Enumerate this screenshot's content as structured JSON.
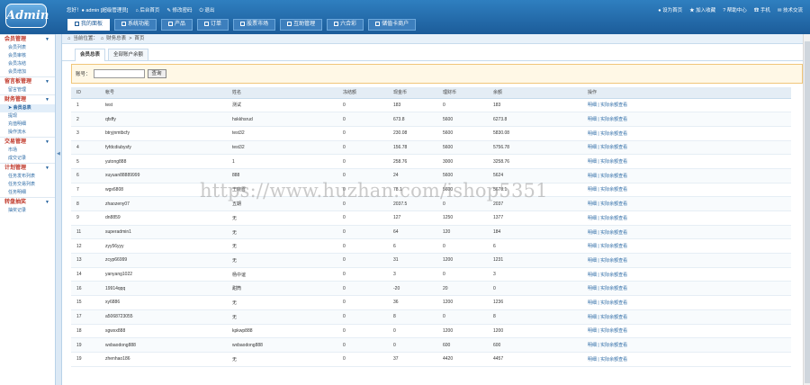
{
  "app": {
    "logo": "Admin",
    "user_prefix": "您好！",
    "user_name": "admin",
    "user_role": "[超级管理员]",
    "links": [
      "后台首页",
      "修改密码",
      "退出"
    ],
    "right_links": [
      "设为首页",
      "加入收藏",
      "帮助中心",
      "手机",
      "技术交流"
    ]
  },
  "tabs": [
    "我的面板",
    "系统功能",
    "产品",
    "订单",
    "股票市场",
    "互助管理",
    "六合彩",
    "储值卡商户"
  ],
  "sidebar": [
    {
      "title": "会员管理",
      "items": [
        "会员列表",
        "会员审核",
        "会员冻结",
        "会员增加"
      ]
    },
    {
      "title": "留言板管理",
      "items": [
        "留言管理"
      ]
    },
    {
      "title": "财务管理",
      "items": [
        "会员总表",
        "提现",
        "充值明细",
        "操作流水"
      ],
      "active": 0
    },
    {
      "title": "交易管理",
      "items": [
        "市场",
        "成交记录"
      ]
    },
    {
      "title": "计划管理",
      "items": [
        "任务发布列表",
        "任务交易列表",
        "任务明细"
      ]
    },
    {
      "title": "转盘抽奖",
      "items": [
        "抽奖记录"
      ]
    }
  ],
  "breadcrumb": {
    "prefix": "当前位置：",
    "parts": [
      "财务总表",
      "首页"
    ]
  },
  "subtabs": [
    "会员总表",
    "全部账户余额"
  ],
  "search": {
    "label": "账号：",
    "value": "",
    "button": "查询"
  },
  "table": {
    "columns": [
      "ID",
      "帐号",
      "姓名",
      "冻结额",
      "现金币",
      "理财币",
      "余额",
      "操作"
    ],
    "rows": [
      [
        "1",
        "test",
        "测试",
        "0",
        "183",
        "0",
        "183",
        "明细 | 实际余额查看"
      ],
      [
        "2",
        "qfsffy",
        "hskkhsrud",
        "0",
        "673.8",
        "5600",
        "6273.8",
        "明细 | 实际余额查看"
      ],
      [
        "3",
        "btryjnmtbcfy",
        "test32",
        "0",
        "230.08",
        "5600",
        "5830.08",
        "明细 | 实际余额查看"
      ],
      [
        "4",
        "fyfdcdiubysfy",
        "test32",
        "0",
        "156.78",
        "5600",
        "5756.78",
        "明细 | 实际余额查看"
      ],
      [
        "5",
        "yutong888",
        "1",
        "0",
        "258.76",
        "3000",
        "3258.76",
        "明细 | 实际余额查看"
      ],
      [
        "6",
        "xuyuan88889999",
        "888",
        "0",
        "24",
        "5600",
        "5624",
        "明细 | 实际余额查看"
      ],
      [
        "7",
        "wgx6808",
        "王晓雪",
        "0",
        "78.1",
        "5600",
        "5678.1",
        "明细 | 实际余额查看"
      ],
      [
        "8",
        "zhaozeny07",
        "五期",
        "0",
        "2037.5",
        "0",
        "2037",
        "明细 | 实际余额查看"
      ],
      [
        "9",
        "dn8859",
        "无",
        "0",
        "127",
        "1250",
        "1377",
        "明细 | 实际余额查看"
      ],
      [
        "11",
        "superadmin1",
        "无",
        "0",
        "64",
        "120",
        "184",
        "明细 | 实际余额查看"
      ],
      [
        "12",
        "zyy56yyy",
        "无",
        "0",
        "6",
        "0",
        "6",
        "明细 | 实际余额查看"
      ],
      [
        "13",
        "zcyp66999",
        "无",
        "0",
        "31",
        "1200",
        "1231",
        "明细 | 实际余额查看"
      ],
      [
        "14",
        "yanyang1022",
        "杨中谊",
        "0",
        "3",
        "0",
        "3",
        "明细 | 实际余额查看"
      ],
      [
        "16",
        "19914qqq",
        "甜筒",
        "0",
        "-20",
        "20",
        "0",
        "明细 | 实际余额查看"
      ],
      [
        "15",
        "xy6886",
        "无",
        "0",
        "36",
        "1200",
        "1236",
        "明细 | 实际余额查看"
      ],
      [
        "17",
        "a5068723055",
        "无",
        "0",
        "8",
        "0",
        "8",
        "明细 | 实际余额查看"
      ],
      [
        "18",
        "sgwxx888",
        "kpkwp888",
        "0",
        "0",
        "1200",
        "1200",
        "明细 | 实际余额查看"
      ],
      [
        "19",
        "wxbaodong888",
        "wxbaodong888",
        "0",
        "0",
        "600",
        "600",
        "明细 | 实际余额查看"
      ],
      [
        "19",
        "zhenhao186",
        "无",
        "0",
        "37",
        "4420",
        "4457",
        "明细 | 实际余额查看"
      ]
    ]
  },
  "watermark": "https://www.huzhan.com/ishop5351"
}
